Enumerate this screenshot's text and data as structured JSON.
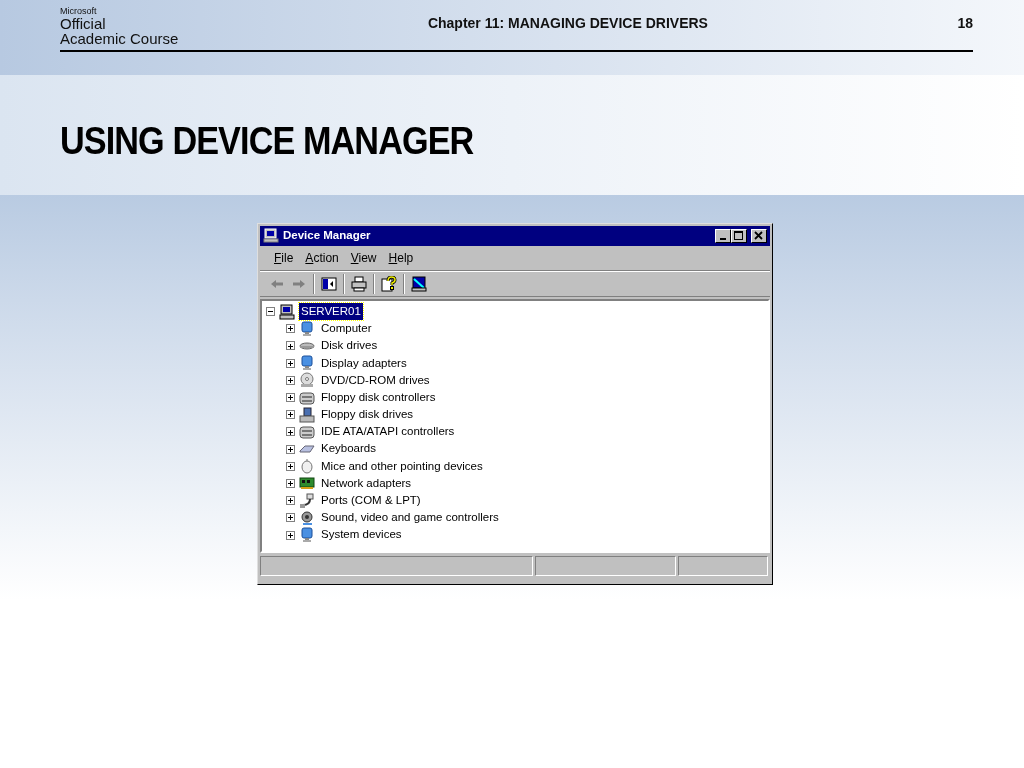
{
  "header": {
    "logo_lines": [
      "Microsoft",
      "Official",
      "Academic Course"
    ],
    "chapter": "Chapter 11: MANAGING DEVICE DRIVERS",
    "page": "18"
  },
  "title": "USING DEVICE MANAGER",
  "window": {
    "title": "Device Manager",
    "menu": [
      {
        "key": "F",
        "rest": "ile"
      },
      {
        "key": "A",
        "rest": "ction"
      },
      {
        "key": "V",
        "rest": "iew"
      },
      {
        "key": "H",
        "rest": "elp"
      }
    ],
    "toolbar": [
      {
        "kind": "back",
        "disabled": true
      },
      {
        "kind": "forward",
        "disabled": true
      },
      {
        "kind": "sep"
      },
      {
        "kind": "tree",
        "disabled": false
      },
      {
        "kind": "sep"
      },
      {
        "kind": "print",
        "disabled": false
      },
      {
        "kind": "sep"
      },
      {
        "kind": "help",
        "disabled": false
      },
      {
        "kind": "sep"
      },
      {
        "kind": "scan",
        "disabled": false
      }
    ],
    "tree": {
      "label": "SERVER01",
      "kind": "computer",
      "expanded": true,
      "selected": true,
      "children": [
        {
          "label": "Computer",
          "kind": "monitor",
          "expanded": false,
          "selected": false
        },
        {
          "label": "Disk drives",
          "kind": "disk",
          "expanded": false,
          "selected": false
        },
        {
          "label": "Display adapters",
          "kind": "monitor",
          "expanded": false,
          "selected": false
        },
        {
          "label": "DVD/CD-ROM drives",
          "kind": "dvd",
          "expanded": false,
          "selected": false
        },
        {
          "label": "Floppy disk controllers",
          "kind": "controller",
          "expanded": false,
          "selected": false
        },
        {
          "label": "Floppy disk drives",
          "kind": "floppy",
          "expanded": false,
          "selected": false
        },
        {
          "label": "IDE ATA/ATAPI controllers",
          "kind": "controller",
          "expanded": false,
          "selected": false
        },
        {
          "label": "Keyboards",
          "kind": "keyboard",
          "expanded": false,
          "selected": false
        },
        {
          "label": "Mice and other pointing devices",
          "kind": "mouse",
          "expanded": false,
          "selected": false
        },
        {
          "label": "Network adapters",
          "kind": "network",
          "expanded": false,
          "selected": false
        },
        {
          "label": "Ports (COM & LPT)",
          "kind": "port",
          "expanded": false,
          "selected": false
        },
        {
          "label": "Sound, video and game controllers",
          "kind": "sound",
          "expanded": false,
          "selected": false
        },
        {
          "label": "System devices",
          "kind": "monitor",
          "expanded": false,
          "selected": false
        }
      ]
    }
  }
}
